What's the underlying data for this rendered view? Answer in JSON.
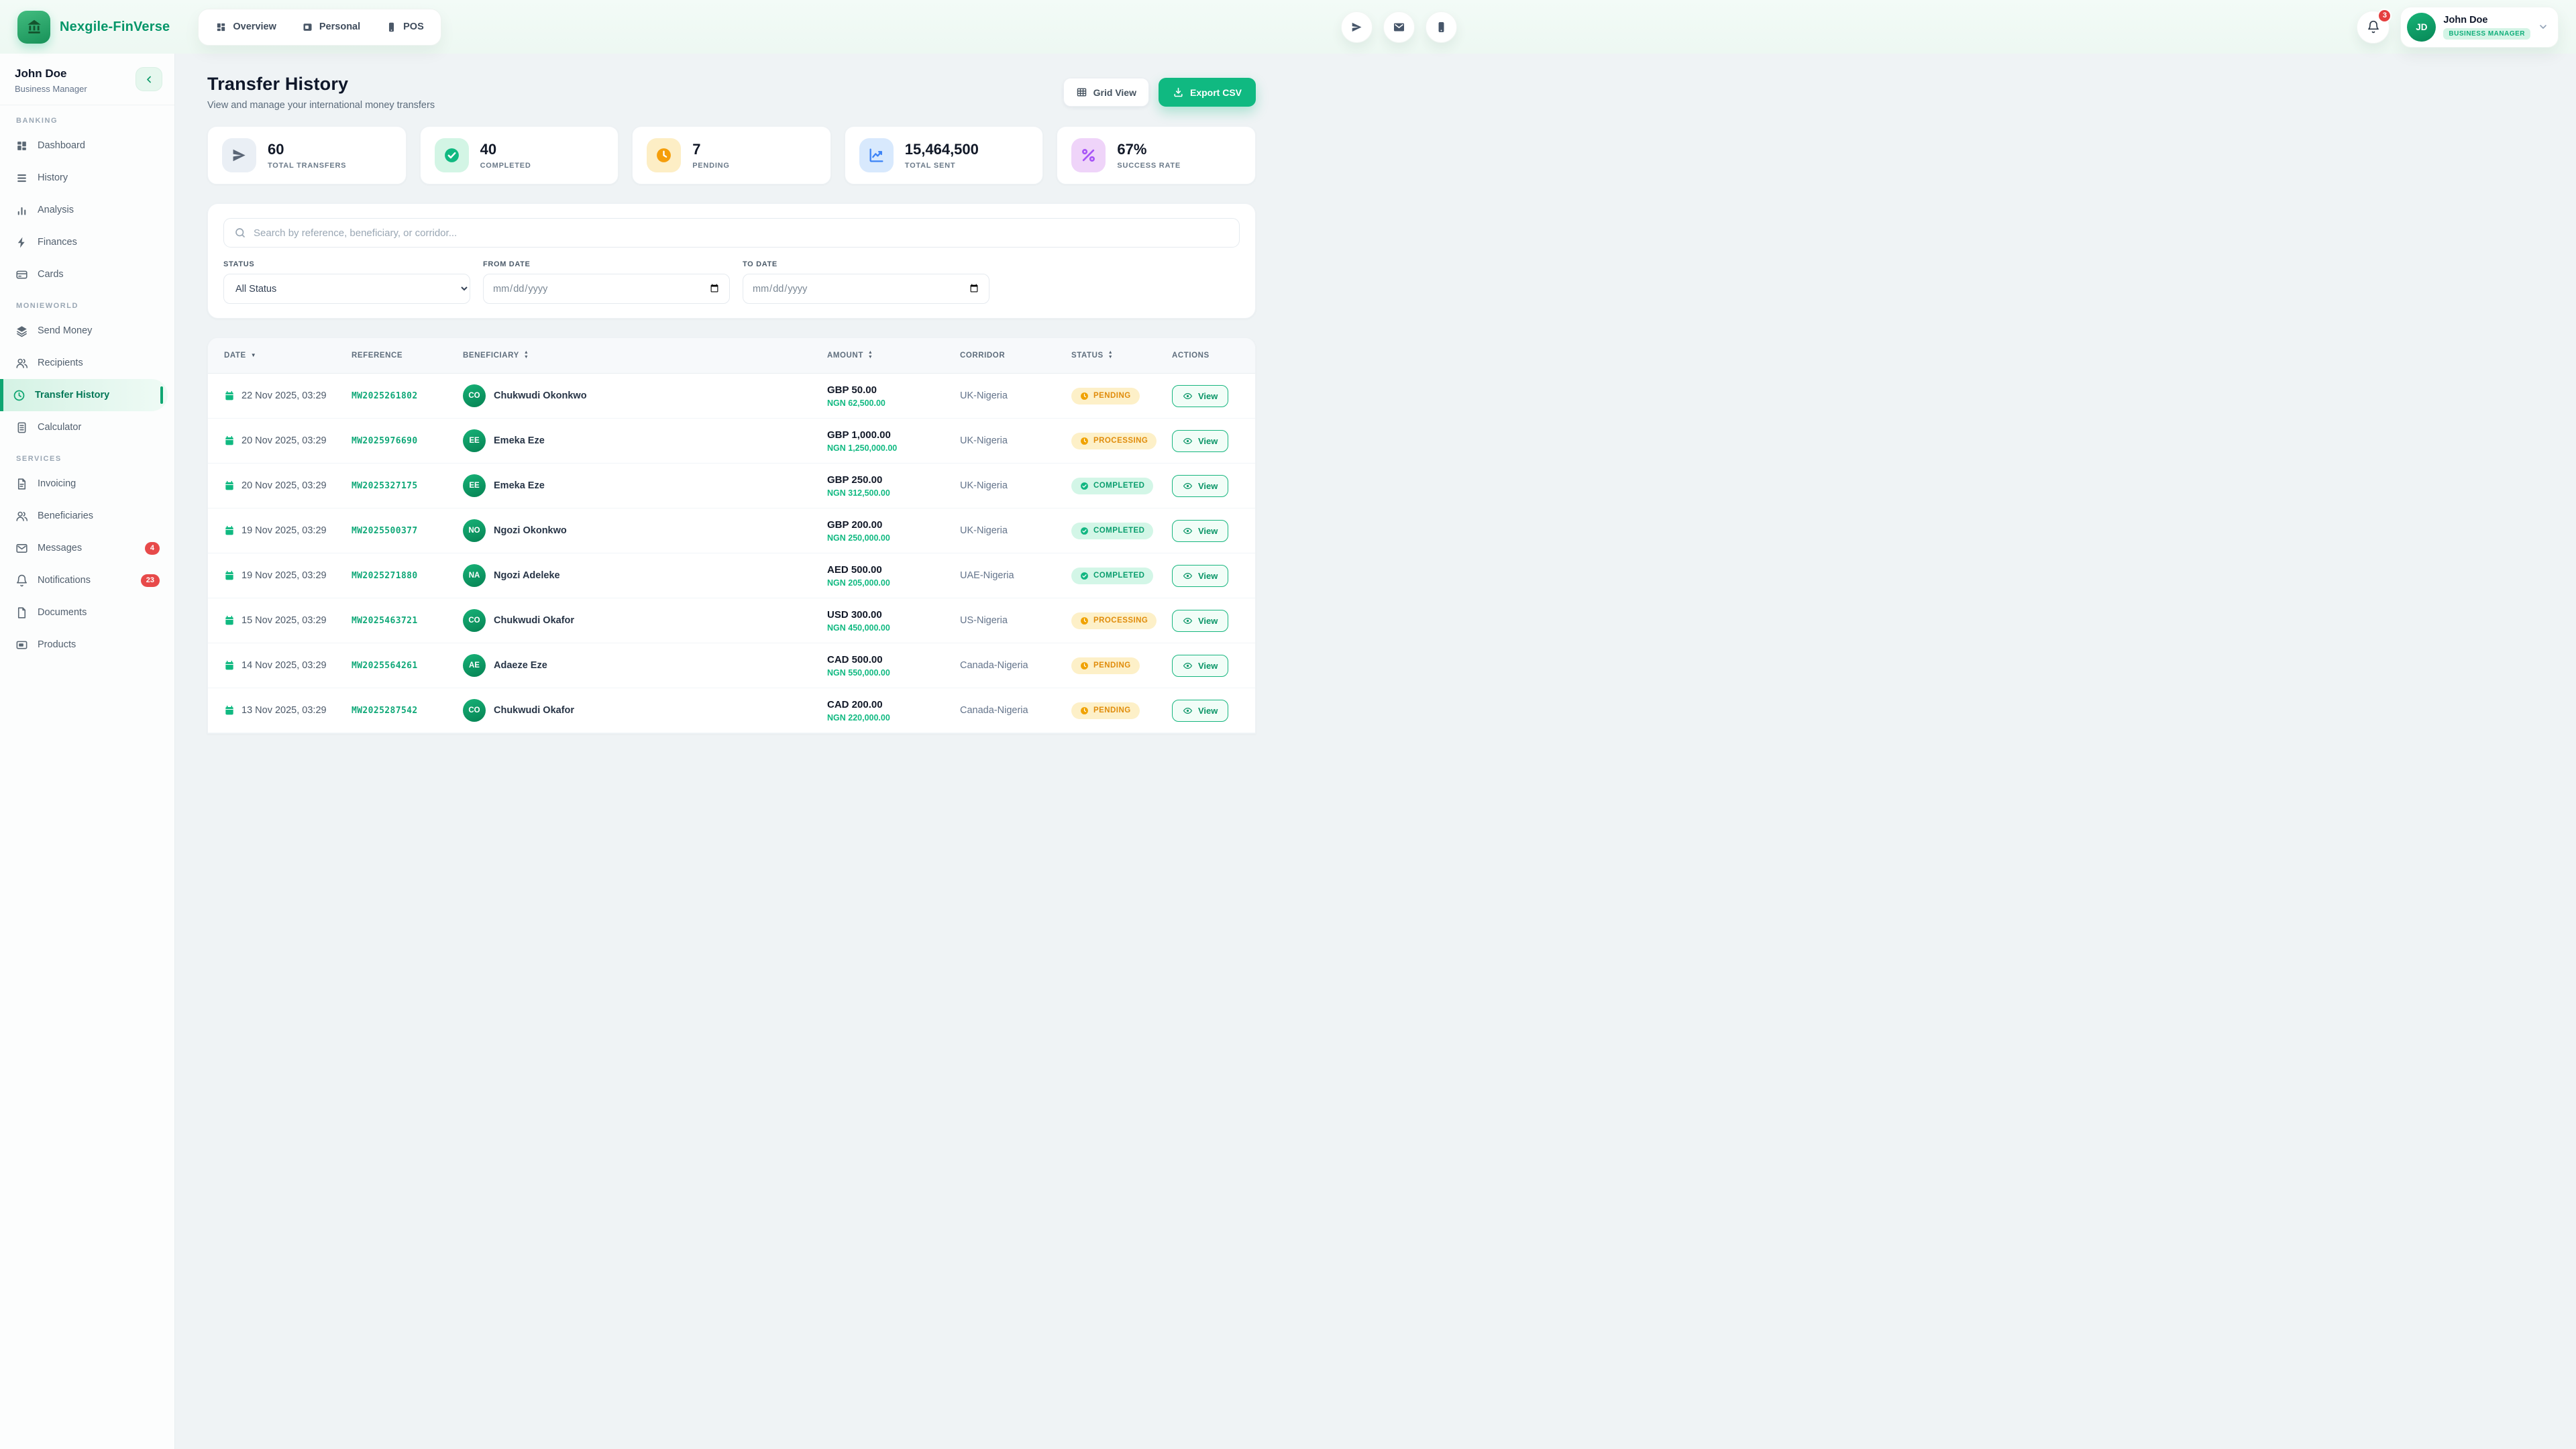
{
  "brand": {
    "name": "Nexgile-FinVerse"
  },
  "header": {
    "nav": [
      {
        "label": "Overview",
        "icon": "overview"
      },
      {
        "label": "Personal",
        "icon": "card"
      },
      {
        "label": "POS",
        "icon": "smartphone"
      }
    ],
    "quick_icons": [
      "send",
      "mail",
      "smartphone"
    ],
    "notifications_count": "3",
    "user": {
      "initials": "JD",
      "name": "John Doe",
      "role_badge": "BUSINESS MANAGER"
    }
  },
  "sidebar": {
    "user": {
      "name": "John Doe",
      "role": "Business Manager"
    },
    "sections": [
      {
        "title": "BANKING",
        "items": [
          {
            "label": "Dashboard",
            "icon": "dashboard"
          },
          {
            "label": "History",
            "icon": "menu"
          },
          {
            "label": "Analysis",
            "icon": "bar-chart"
          },
          {
            "label": "Finances",
            "icon": "zap"
          },
          {
            "label": "Cards",
            "icon": "credit-card"
          }
        ]
      },
      {
        "title": "MONIEWORLD",
        "items": [
          {
            "label": "Send Money",
            "icon": "layers"
          },
          {
            "label": "Recipients",
            "icon": "users"
          },
          {
            "label": "Transfer History",
            "icon": "clock",
            "active": true
          },
          {
            "label": "Calculator",
            "icon": "calculator"
          }
        ]
      },
      {
        "title": "SERVICES",
        "items": [
          {
            "label": "Invoicing",
            "icon": "file-text"
          },
          {
            "label": "Beneficiaries",
            "icon": "users"
          },
          {
            "label": "Messages",
            "icon": "mail-outline",
            "badge": "4"
          },
          {
            "label": "Notifications",
            "icon": "bell",
            "badge": "23"
          },
          {
            "label": "Documents",
            "icon": "file"
          },
          {
            "label": "Products",
            "icon": "box"
          }
        ]
      }
    ]
  },
  "page": {
    "title": "Transfer History",
    "subtitle": "View and manage your international money transfers",
    "grid_view_label": "Grid View",
    "export_label": "Export CSV"
  },
  "stats": [
    {
      "value": "60",
      "label": "TOTAL TRANSFERS",
      "icon": "send",
      "style": "slate"
    },
    {
      "value": "40",
      "label": "COMPLETED",
      "icon": "check-circle",
      "style": "green"
    },
    {
      "value": "7",
      "label": "PENDING",
      "icon": "clock-filled",
      "style": "amber"
    },
    {
      "value": "15,464,500",
      "label": "TOTAL SENT",
      "icon": "trend",
      "style": "blue"
    },
    {
      "value": "67%",
      "label": "SUCCESS RATE",
      "icon": "percent",
      "style": "purple"
    }
  ],
  "filters": {
    "search_placeholder": "Search by reference, beneficiary, or corridor...",
    "status_label": "STATUS",
    "status_value": "All Status",
    "from_label": "FROM DATE",
    "to_label": "TO DATE",
    "date_placeholder": "mm/dd/yyyy"
  },
  "table": {
    "columns": [
      {
        "label": "DATE",
        "sort": "down"
      },
      {
        "label": "REFERENCE",
        "sort": "none"
      },
      {
        "label": "BENEFICIARY",
        "sort": "both"
      },
      {
        "label": "AMOUNT",
        "sort": "both"
      },
      {
        "label": "CORRIDOR",
        "sort": "none"
      },
      {
        "label": "STATUS",
        "sort": "both"
      },
      {
        "label": "ACTIONS",
        "sort": "none"
      }
    ],
    "view_label": "View",
    "rows": [
      {
        "date": "22 Nov 2025, 03:29",
        "reference": "MW2025261802",
        "initials": "CO",
        "beneficiary": "Chukwudi Okonkwo",
        "amount": "GBP 50.00",
        "ngn": "NGN 62,500.00",
        "corridor": "UK-Nigeria",
        "status": "PENDING"
      },
      {
        "date": "20 Nov 2025, 03:29",
        "reference": "MW2025976690",
        "initials": "EE",
        "beneficiary": "Emeka Eze",
        "amount": "GBP 1,000.00",
        "ngn": "NGN 1,250,000.00",
        "corridor": "UK-Nigeria",
        "status": "PROCESSING"
      },
      {
        "date": "20 Nov 2025, 03:29",
        "reference": "MW2025327175",
        "initials": "EE",
        "beneficiary": "Emeka Eze",
        "amount": "GBP 250.00",
        "ngn": "NGN 312,500.00",
        "corridor": "UK-Nigeria",
        "status": "COMPLETED"
      },
      {
        "date": "19 Nov 2025, 03:29",
        "reference": "MW2025500377",
        "initials": "NO",
        "beneficiary": "Ngozi Okonkwo",
        "amount": "GBP 200.00",
        "ngn": "NGN 250,000.00",
        "corridor": "UK-Nigeria",
        "status": "COMPLETED"
      },
      {
        "date": "19 Nov 2025, 03:29",
        "reference": "MW2025271880",
        "initials": "NA",
        "beneficiary": "Ngozi Adeleke",
        "amount": "AED 500.00",
        "ngn": "NGN 205,000.00",
        "corridor": "UAE-Nigeria",
        "status": "COMPLETED"
      },
      {
        "date": "15 Nov 2025, 03:29",
        "reference": "MW2025463721",
        "initials": "CO",
        "beneficiary": "Chukwudi Okafor",
        "amount": "USD 300.00",
        "ngn": "NGN 450,000.00",
        "corridor": "US-Nigeria",
        "status": "PROCESSING"
      },
      {
        "date": "14 Nov 2025, 03:29",
        "reference": "MW2025564261",
        "initials": "AE",
        "beneficiary": "Adaeze Eze",
        "amount": "CAD 500.00",
        "ngn": "NGN 550,000.00",
        "corridor": "Canada-Nigeria",
        "status": "PENDING"
      },
      {
        "date": "13 Nov 2025, 03:29",
        "reference": "MW2025287542",
        "initials": "CO",
        "beneficiary": "Chukwudi Okafor",
        "amount": "CAD 200.00",
        "ngn": "NGN 220,000.00",
        "corridor": "Canada-Nigeria",
        "status": "PENDING"
      }
    ]
  },
  "colors": {
    "accent": "#10b981",
    "accent_dark": "#047857",
    "warning": "#f59e0b",
    "danger": "#e53e3e",
    "info": "#3b82f6",
    "purple": "#a855f7"
  }
}
